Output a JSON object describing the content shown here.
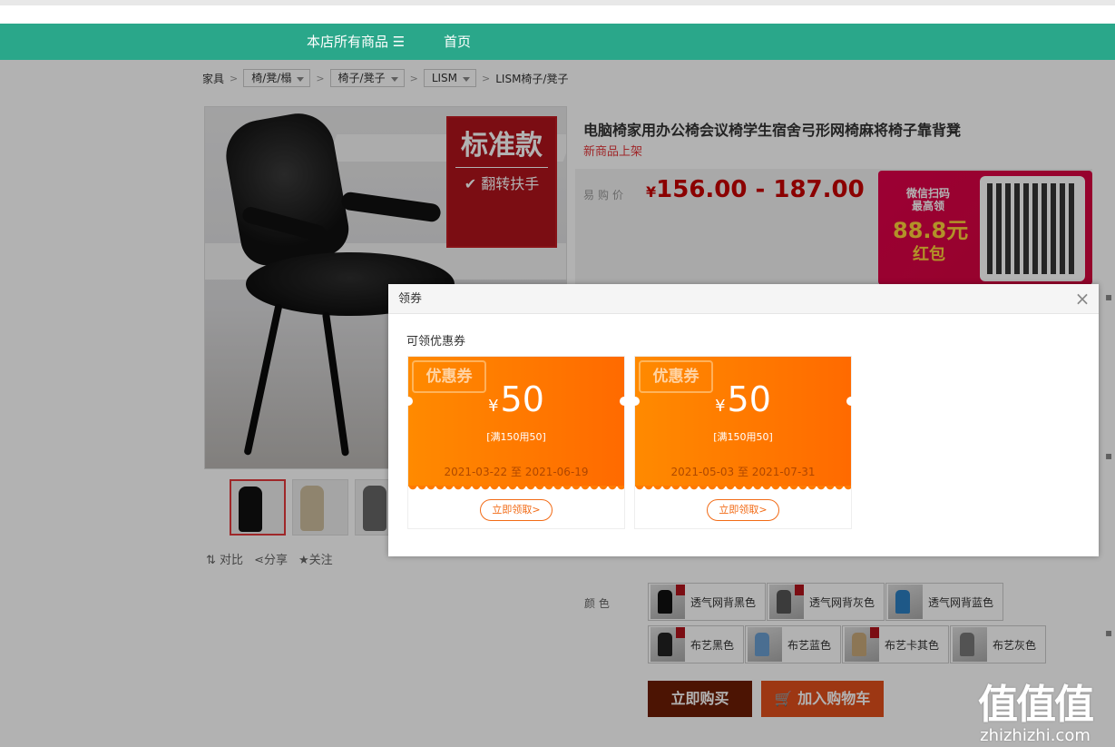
{
  "nav": {
    "all_products": "本店所有商品 ☰",
    "home": "首页"
  },
  "breadcrumb": {
    "root": "家具",
    "cat1": "椅/凳/榻",
    "cat2": "椅子/凳子",
    "brand": "LISM",
    "current": "LISM椅子/凳子"
  },
  "main_image": {
    "badge_title": "标准款",
    "badge_sub": "✔ 翻转扶手"
  },
  "actions": {
    "compare": "对比",
    "share": "分享",
    "follow": "关注"
  },
  "product": {
    "title": "电脑椅家用办公椅会议椅学生宿舍弓形网椅麻将椅子靠背凳",
    "subtitle": "新商品上架",
    "price_label": "易购价",
    "currency": "¥",
    "price": "156.00 - 187.00"
  },
  "promo": {
    "line1": "微信扫码\n最高领",
    "amount": "88.8元",
    "line3": "红包"
  },
  "colors": {
    "label": "颜 色",
    "options": [
      "透气网背黑色",
      "透气网背灰色",
      "透气网背蓝色",
      "布艺黑色",
      "布艺蓝色",
      "布艺卡其色",
      "布艺灰色"
    ]
  },
  "buttons": {
    "buy_now": "立即购买",
    "add_cart": "加入购物车"
  },
  "modal": {
    "title": "领券",
    "subtitle": "可领优惠券",
    "close": "×",
    "coupons": [
      {
        "tag": "优惠券",
        "currency": "¥",
        "amount": "50",
        "condition": "[满150用50]",
        "dates": "2021-03-22 至 2021-06-19",
        "button": "立即领取>"
      },
      {
        "tag": "优惠券",
        "currency": "¥",
        "amount": "50",
        "condition": "[满150用50]",
        "dates": "2021-05-03 至 2021-07-31",
        "button": "立即领取>"
      }
    ]
  },
  "watermark": {
    "logo": "值值值",
    "domain": "zhizhizhi.com"
  }
}
